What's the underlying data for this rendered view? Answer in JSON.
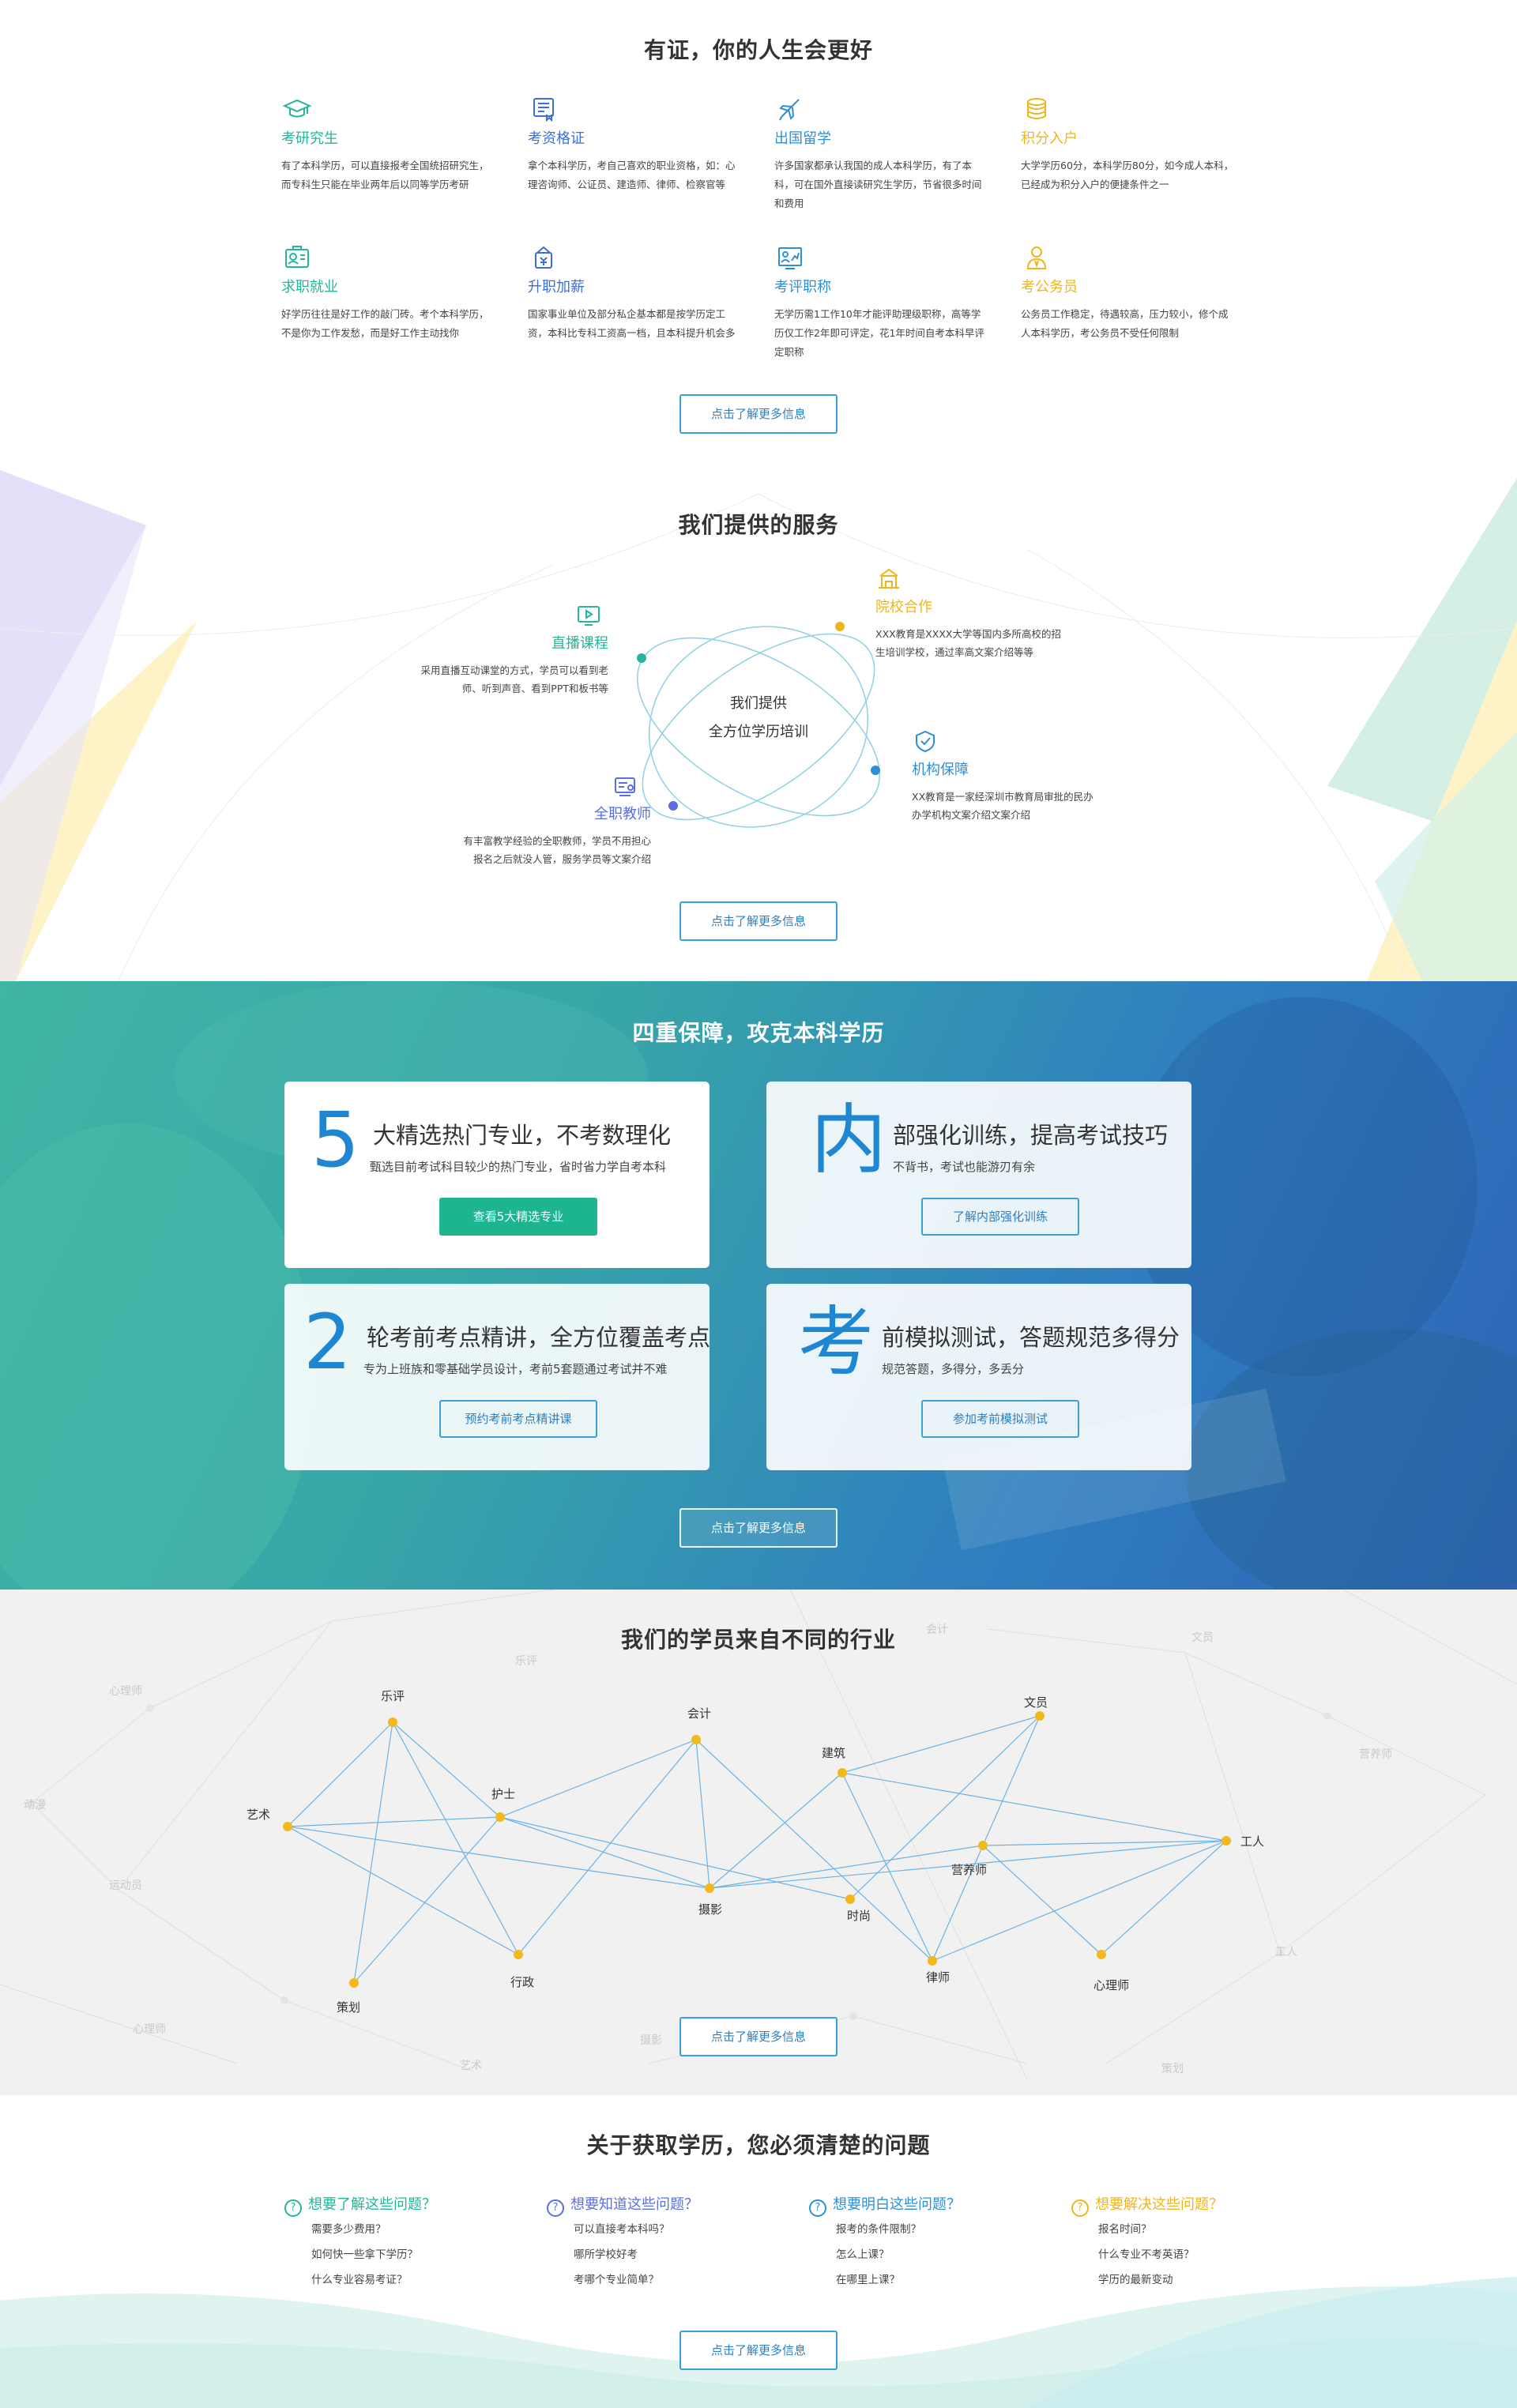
{
  "s1": {
    "title": "有证，你的人生会更好",
    "items": [
      {
        "title": "考研究生",
        "color": "#24b59a",
        "icon": "graduation-cap-icon",
        "desc": "有了本科学历，可以直接报考全国统招研究生，而专科生只能在毕业两年后以同等学历考研"
      },
      {
        "title": "考资格证",
        "color": "#3d6fd6",
        "icon": "certificate-icon",
        "desc": "拿个本科学历，考自己喜欢的职业资格，如：心理咨询师、公证员、建造师、律师、检察官等"
      },
      {
        "title": "出国留学",
        "color": "#2d8fd6",
        "icon": "airplane-icon",
        "desc": "许多国家都承认我国的成人本科学历，有了本科，可在国外直接读研究生学历，节省很多时间和费用"
      },
      {
        "title": "积分入户",
        "color": "#efb51e",
        "icon": "coins-icon",
        "desc": "大学学历60分，本科学历80分，如今成人本科，已经成为积分入户的便捷条件之一"
      },
      {
        "title": "求职就业",
        "color": "#24b59a",
        "icon": "id-card-icon",
        "desc": "好学历往往是好工作的敲门砖。考个本科学历，不是你为工作发愁，而是好工作主动找你"
      },
      {
        "title": "升职加薪",
        "color": "#3d6fd6",
        "icon": "money-bag-icon",
        "desc": "国家事业单位及部分私企基本都是按学历定工资，本科比专科工资高一档，且本科提升机会多"
      },
      {
        "title": "考评职称",
        "color": "#2d8fd6",
        "icon": "chart-board-icon",
        "desc": "无学历需1工作10年才能评助理级职称，高等学历仅工作2年即可评定，花1年时间自考本科早评定职称"
      },
      {
        "title": "考公务员",
        "color": "#efb51e",
        "icon": "civil-servant-icon",
        "desc": "公务员工作稳定，待遇较高，压力较小，修个成人本科学历，考公务员不受任何限制"
      }
    ],
    "more": "点击了解更多信息"
  },
  "s2": {
    "title": "我们提供的服务",
    "center": [
      "我们提供",
      "全方位学历培训"
    ],
    "items": [
      {
        "title": "直播课程",
        "color": "#24b59a",
        "icon": "live-video-icon",
        "desc": [
          "采用直播互动课堂的方式，学员可以看到老",
          "师、听到声音、看到PPT和板书等"
        ]
      },
      {
        "title": "院校合作",
        "color": "#efb51e",
        "icon": "school-building-icon",
        "desc": [
          "XXX教育是XXXX大学等国内多所高校的招",
          "生培训学校，通过率高文案介绍等等"
        ]
      },
      {
        "title": "机构保障",
        "color": "#2d8fd6",
        "icon": "shield-icon",
        "desc": [
          "XX教育是一家经深圳市教育局审批的民办",
          "办学机构文案介绍文案介绍"
        ]
      },
      {
        "title": "全职教师",
        "color": "#5b6fe0",
        "icon": "teacher-icon",
        "desc": [
          "有丰富教学经验的全职教师，学员不用担心",
          "报名之后就没人管，服务学员等文案介绍"
        ]
      }
    ],
    "more": "点击了解更多信息"
  },
  "s3": {
    "title": "四重保障，攻克本科学历",
    "cards": [
      {
        "big": "5",
        "head": "大精选热门专业，不考数理化",
        "sub": "甄选目前考试科目较少的热门专业，省时省力学自考本科",
        "button": "查看5大精选专业"
      },
      {
        "big": "内",
        "head": "部强化训练，提高考试技巧",
        "sub": "不背书，考试也能游刃有余",
        "button": "了解内部强化训练"
      },
      {
        "big": "2",
        "head": "轮考前考点精讲，全方位覆盖考点",
        "sub": "专为上班族和零基础学员设计，考前5套题通过考试并不难",
        "button": "预约考前考点精讲课"
      },
      {
        "big": "考",
        "head": "前模拟测试，答题规范多得分",
        "sub": "规范答题，多得分，多丢分",
        "button": "参加考前模拟测试"
      }
    ],
    "more": "点击了解更多信息"
  },
  "s4": {
    "title": "我们的学员来自不同的行业",
    "nodes": [
      "乐评",
      "会计",
      "文员",
      "建筑",
      "护士",
      "艺术",
      "工人",
      "营养师",
      "摄影",
      "时尚",
      "律师",
      "心理师",
      "行政",
      "策划"
    ],
    "faint": [
      "心理师",
      "乐评",
      "会计",
      "文员",
      "营养师",
      "动漫",
      "运动员",
      "工人",
      "心理师",
      "艺术",
      "摄影",
      "策划",
      "法律",
      "心理师",
      "建筑",
      "会计",
      "运动员"
    ],
    "more": "点击了解更多信息"
  },
  "s5": {
    "title": "关于获取学历，您必须清楚的问题",
    "cols": [
      {
        "head": "想要了解这些问题？",
        "color": "#24b59a",
        "items": [
          "需要多少费用？",
          "如何快一些拿下学历？",
          "什么专业容易考证？"
        ]
      },
      {
        "head": "想要知道这些问题？",
        "color": "#5b6fe0",
        "items": [
          "可以直接考本科吗？",
          "哪所学校好考",
          "考哪个专业简单？"
        ]
      },
      {
        "head": "想要明白这些问题？",
        "color": "#2d8fd6",
        "items": [
          "报考的条件限制？",
          "怎么上课？",
          "在哪里上课？"
        ]
      },
      {
        "head": "想要解决这些问题？",
        "color": "#efb51e",
        "items": [
          "报名时间？",
          "什么专业不考英语？",
          "学历的最新变动"
        ]
      }
    ],
    "more": "点击了解更多信息"
  }
}
